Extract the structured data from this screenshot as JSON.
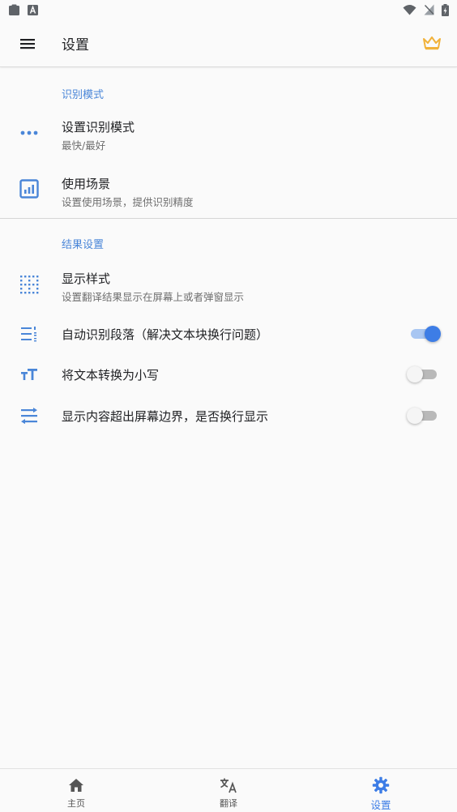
{
  "status_bar": {
    "icons": [
      "clipboard-icon",
      "keyboard-a-icon",
      "wifi-icon",
      "signal-off-icon",
      "battery-charging-icon"
    ]
  },
  "app_bar": {
    "title": "设置",
    "menu_icon": "hamburger-menu-icon",
    "premium_icon": "crown-icon",
    "premium_color": "#f1b23a"
  },
  "sections": {
    "recognition": {
      "header": "识别模式",
      "items": [
        {
          "icon": "more-dots-icon",
          "title": "设置识别模式",
          "subtitle": "最快/最好"
        },
        {
          "icon": "bar-chart-icon",
          "title": "使用场景",
          "subtitle": "设置使用场景，提供识别精度"
        }
      ]
    },
    "result": {
      "header": "结果设置",
      "display_style": {
        "icon": "grid-dots-icon",
        "title": "显示样式",
        "subtitle": "设置翻译结果显示在屏幕上或者弹窗显示"
      },
      "toggles": [
        {
          "icon": "paragraph-list-icon",
          "title": "自动识别段落（解决文本块换行问题）",
          "on": true
        },
        {
          "icon": "text-case-icon",
          "title": "将文本转换为小写",
          "on": false
        },
        {
          "icon": "wrap-text-icon",
          "title": "显示内容超出屏幕边界，是否换行显示",
          "on": false
        }
      ]
    }
  },
  "bottom_nav": {
    "items": [
      {
        "icon": "home-icon",
        "label": "主页",
        "active": false
      },
      {
        "icon": "translate-icon",
        "label": "翻译",
        "active": false
      },
      {
        "icon": "settings-gear-icon",
        "label": "设置",
        "active": true
      }
    ]
  },
  "colors": {
    "accent": "#3d7de6",
    "section_header": "#4a86d8",
    "icon_blue": "#4a86d8",
    "background": "#fafafa"
  }
}
